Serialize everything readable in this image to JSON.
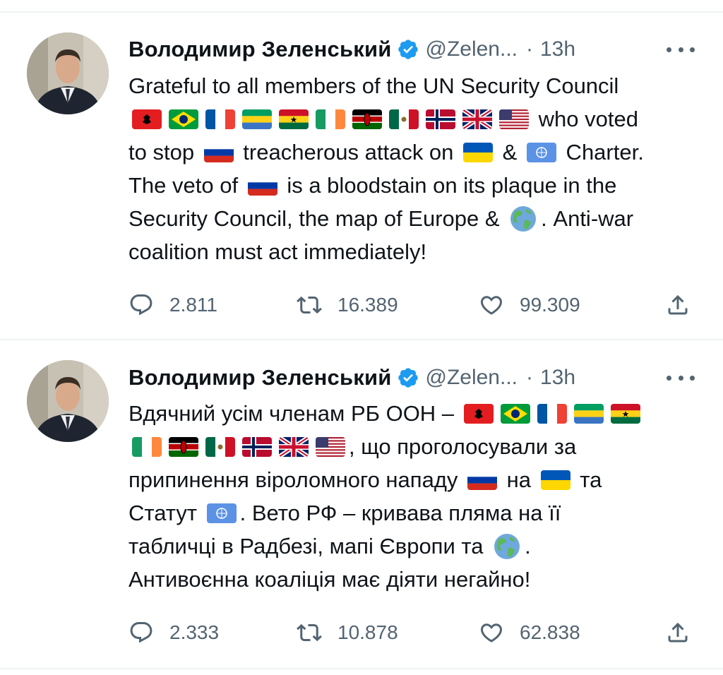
{
  "tweets": [
    {
      "author_name": "Володимир Зеленський",
      "handle": "@Zelen...",
      "dot": "·",
      "time": "13h",
      "lines": [
        [
          {
            "t": "text",
            "v": "Grateful to all members of the UN Security Council"
          }
        ],
        [
          {
            "t": "flag",
            "v": "al"
          },
          {
            "t": "flag",
            "v": "br"
          },
          {
            "t": "flag",
            "v": "fr"
          },
          {
            "t": "flag",
            "v": "ga"
          },
          {
            "t": "flag",
            "v": "gh"
          },
          {
            "t": "flag",
            "v": "ie"
          },
          {
            "t": "flag",
            "v": "ke"
          },
          {
            "t": "flag",
            "v": "mx"
          },
          {
            "t": "flag",
            "v": "no"
          },
          {
            "t": "flag",
            "v": "gb"
          },
          {
            "t": "flag",
            "v": "us"
          },
          {
            "t": "text",
            "v": " who voted"
          }
        ],
        [
          {
            "t": "text",
            "v": "to stop "
          },
          {
            "t": "flag",
            "v": "ru"
          },
          {
            "t": "text",
            "v": " treacherous attack on "
          },
          {
            "t": "flag",
            "v": "ua"
          },
          {
            "t": "text",
            "v": " & "
          },
          {
            "t": "flag",
            "v": "un"
          },
          {
            "t": "text",
            "v": " Charter."
          }
        ],
        [
          {
            "t": "text",
            "v": "The veto of "
          },
          {
            "t": "flag",
            "v": "ru"
          },
          {
            "t": "text",
            "v": " is a bloodstain on its plaque in the"
          }
        ],
        [
          {
            "t": "text",
            "v": "Security Council, the map of Europe & "
          },
          {
            "t": "globe",
            "v": "globe"
          },
          {
            "t": "text",
            "v": ". Anti-war"
          }
        ],
        [
          {
            "t": "text",
            "v": "coalition must act immediately!"
          }
        ]
      ],
      "replies": "2.811",
      "retweets": "16.389",
      "likes": "99.309"
    },
    {
      "author_name": "Володимир Зеленський",
      "handle": "@Zelen...",
      "dot": "·",
      "time": "13h",
      "lines": [
        [
          {
            "t": "text",
            "v": "Вдячний усім членам РБ ООН – "
          },
          {
            "t": "flag",
            "v": "al"
          },
          {
            "t": "flag",
            "v": "br"
          },
          {
            "t": "flag",
            "v": "fr"
          },
          {
            "t": "flag",
            "v": "ga"
          },
          {
            "t": "flag",
            "v": "gh"
          }
        ],
        [
          {
            "t": "flag",
            "v": "ie"
          },
          {
            "t": "flag",
            "v": "ke"
          },
          {
            "t": "flag",
            "v": "mx"
          },
          {
            "t": "flag",
            "v": "no"
          },
          {
            "t": "flag",
            "v": "gb"
          },
          {
            "t": "flag",
            "v": "us"
          },
          {
            "t": "text",
            "v": ", що проголосували за"
          }
        ],
        [
          {
            "t": "text",
            "v": "припинення віроломного нападу "
          },
          {
            "t": "flag",
            "v": "ru"
          },
          {
            "t": "text",
            "v": " на "
          },
          {
            "t": "flag",
            "v": "ua"
          },
          {
            "t": "text",
            "v": " та"
          }
        ],
        [
          {
            "t": "text",
            "v": "Статут "
          },
          {
            "t": "flag",
            "v": "un"
          },
          {
            "t": "text",
            "v": ". Вето РФ – кривава пляма на її"
          }
        ],
        [
          {
            "t": "text",
            "v": "табличці в Радбезі, мапі Європи та "
          },
          {
            "t": "globe",
            "v": "globe"
          },
          {
            "t": "text",
            "v": "."
          }
        ],
        [
          {
            "t": "text",
            "v": "Антивоєнна коаліція має діяти негайно!"
          }
        ]
      ],
      "replies": "2.333",
      "retweets": "10.878",
      "likes": "62.838"
    }
  ],
  "colors": {
    "verified": "#1d9bf0",
    "secondary_text": "#536471",
    "text": "#0f1419"
  }
}
